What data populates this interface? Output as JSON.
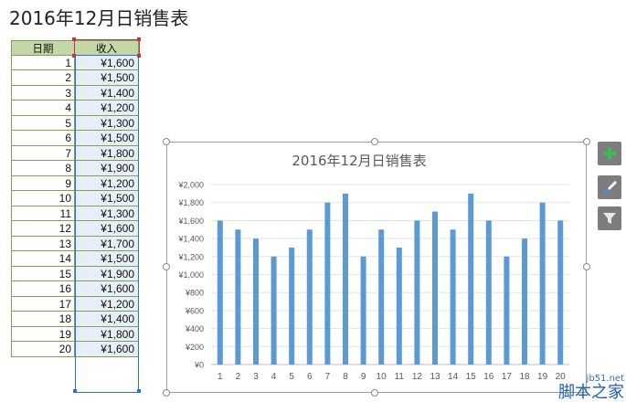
{
  "page_title": "2016年12月日销售表",
  "table": {
    "headers": [
      "日期",
      "收入"
    ],
    "rows": [
      {
        "day": "1",
        "amount": "¥1,600"
      },
      {
        "day": "2",
        "amount": "¥1,500"
      },
      {
        "day": "3",
        "amount": "¥1,400"
      },
      {
        "day": "4",
        "amount": "¥1,200"
      },
      {
        "day": "5",
        "amount": "¥1,300"
      },
      {
        "day": "6",
        "amount": "¥1,500"
      },
      {
        "day": "7",
        "amount": "¥1,800"
      },
      {
        "day": "8",
        "amount": "¥1,900"
      },
      {
        "day": "9",
        "amount": "¥1,200"
      },
      {
        "day": "10",
        "amount": "¥1,500"
      },
      {
        "day": "11",
        "amount": "¥1,300"
      },
      {
        "day": "12",
        "amount": "¥1,600"
      },
      {
        "day": "13",
        "amount": "¥1,700"
      },
      {
        "day": "14",
        "amount": "¥1,500"
      },
      {
        "day": "15",
        "amount": "¥1,900"
      },
      {
        "day": "16",
        "amount": "¥1,600"
      },
      {
        "day": "17",
        "amount": "¥1,200"
      },
      {
        "day": "18",
        "amount": "¥1,400"
      },
      {
        "day": "19",
        "amount": "¥1,800"
      },
      {
        "day": "20",
        "amount": "¥1,600"
      }
    ]
  },
  "chart_data": {
    "type": "bar",
    "title": "2016年12月日销售表",
    "categories": [
      "1",
      "2",
      "3",
      "4",
      "5",
      "6",
      "7",
      "8",
      "9",
      "10",
      "11",
      "12",
      "13",
      "14",
      "15",
      "16",
      "17",
      "18",
      "19",
      "20"
    ],
    "values": [
      1600,
      1500,
      1400,
      1200,
      1300,
      1500,
      1800,
      1900,
      1200,
      1500,
      1300,
      1600,
      1700,
      1500,
      1900,
      1600,
      1200,
      1400,
      1800,
      1600
    ],
    "ylim": [
      0,
      2000
    ],
    "yticks": [
      "¥0",
      "¥200",
      "¥400",
      "¥600",
      "¥800",
      "¥1,000",
      "¥1,200",
      "¥1,400",
      "¥1,600",
      "¥1,800",
      "¥2,000"
    ],
    "grid": true,
    "bar_color": "#5b9bd5"
  },
  "side_buttons": [
    {
      "icon": "plus-icon"
    },
    {
      "icon": "brush-icon"
    },
    {
      "icon": "filter-icon"
    }
  ],
  "watermark": {
    "url": "jb51.net",
    "name": "脚本之家"
  }
}
